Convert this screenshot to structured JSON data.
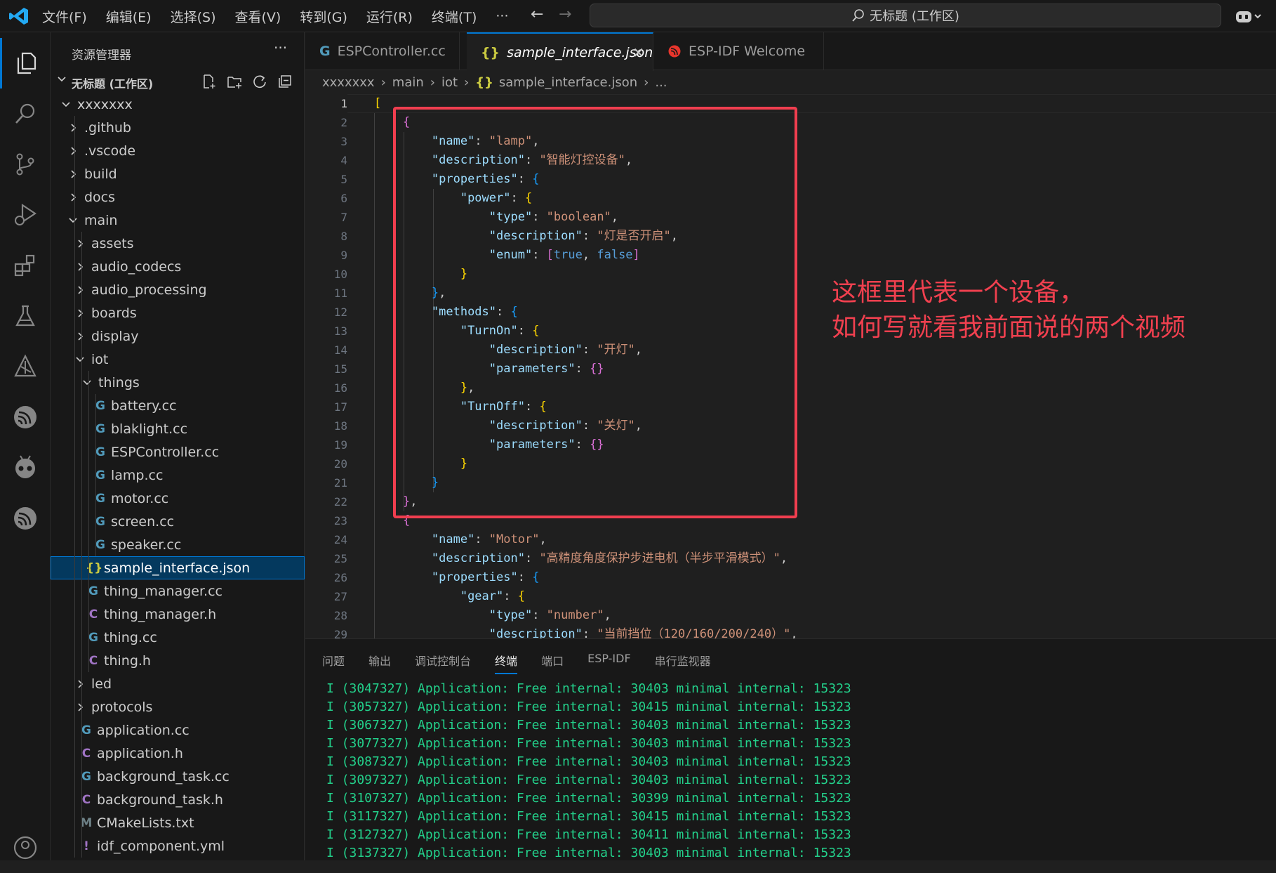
{
  "menu": [
    "文件(F)",
    "编辑(E)",
    "选择(S)",
    "查看(V)",
    "转到(G)",
    "运行(R)",
    "终端(T)",
    "···"
  ],
  "command_center": "无标题 (工作区)",
  "sidebar": {
    "title": "资源管理器",
    "more": "···",
    "workspace": "无标题 (工作区)",
    "tree": [
      {
        "label": "xxxxxxx",
        "depth": 0,
        "kind": "folder-open"
      },
      {
        "label": ".github",
        "depth": 1,
        "kind": "folder"
      },
      {
        "label": ".vscode",
        "depth": 1,
        "kind": "folder"
      },
      {
        "label": "build",
        "depth": 1,
        "kind": "folder"
      },
      {
        "label": "docs",
        "depth": 1,
        "kind": "folder"
      },
      {
        "label": "main",
        "depth": 1,
        "kind": "folder-open"
      },
      {
        "label": "assets",
        "depth": 2,
        "kind": "folder"
      },
      {
        "label": "audio_codecs",
        "depth": 2,
        "kind": "folder"
      },
      {
        "label": "audio_processing",
        "depth": 2,
        "kind": "folder"
      },
      {
        "label": "boards",
        "depth": 2,
        "kind": "folder"
      },
      {
        "label": "display",
        "depth": 2,
        "kind": "folder"
      },
      {
        "label": "iot",
        "depth": 2,
        "kind": "folder-open"
      },
      {
        "label": "things",
        "depth": 3,
        "kind": "folder-open"
      },
      {
        "label": "battery.cc",
        "depth": 4,
        "kind": "cc"
      },
      {
        "label": "blaklight.cc",
        "depth": 4,
        "kind": "cc"
      },
      {
        "label": "ESPController.cc",
        "depth": 4,
        "kind": "cc"
      },
      {
        "label": "lamp.cc",
        "depth": 4,
        "kind": "cc"
      },
      {
        "label": "motor.cc",
        "depth": 4,
        "kind": "cc"
      },
      {
        "label": "screen.cc",
        "depth": 4,
        "kind": "cc"
      },
      {
        "label": "speaker.cc",
        "depth": 4,
        "kind": "cc"
      },
      {
        "label": "sample_interface.json",
        "depth": 3,
        "kind": "json",
        "selected": true
      },
      {
        "label": "thing_manager.cc",
        "depth": 3,
        "kind": "cc"
      },
      {
        "label": "thing_manager.h",
        "depth": 3,
        "kind": "h"
      },
      {
        "label": "thing.cc",
        "depth": 3,
        "kind": "cc"
      },
      {
        "label": "thing.h",
        "depth": 3,
        "kind": "h"
      },
      {
        "label": "led",
        "depth": 2,
        "kind": "folder"
      },
      {
        "label": "protocols",
        "depth": 2,
        "kind": "folder"
      },
      {
        "label": "application.cc",
        "depth": 2,
        "kind": "cc"
      },
      {
        "label": "application.h",
        "depth": 2,
        "kind": "h"
      },
      {
        "label": "background_task.cc",
        "depth": 2,
        "kind": "cc"
      },
      {
        "label": "background_task.h",
        "depth": 2,
        "kind": "h"
      },
      {
        "label": "CMakeLists.txt",
        "depth": 2,
        "kind": "cmake"
      },
      {
        "label": "idf_component.yml",
        "depth": 2,
        "kind": "yml"
      }
    ]
  },
  "tabs": [
    {
      "label": "ESPController.cc",
      "icon": "cc"
    },
    {
      "label": "sample_interface.json",
      "icon": "json",
      "active": true
    },
    {
      "label": "ESP-IDF Welcome",
      "icon": "espressif"
    }
  ],
  "breadcrumb": [
    "xxxxxxx",
    "main",
    "iot",
    "sample_interface.json",
    "..."
  ],
  "editor": {
    "line_numbers": [
      "1",
      "2",
      "3",
      "4",
      "5",
      "6",
      "7",
      "8",
      "9",
      "10",
      "11",
      "12",
      "13",
      "14",
      "15",
      "16",
      "17",
      "18",
      "19",
      "20",
      "21",
      "22",
      "23",
      "24",
      "25",
      "26",
      "27",
      "28",
      "29"
    ],
    "lines": [
      [
        [
          "b1",
          "["
        ]
      ],
      [
        [
          "p",
          "    "
        ],
        [
          "b2",
          "{"
        ]
      ],
      [
        [
          "p",
          "        "
        ],
        [
          "k",
          "\"name\""
        ],
        [
          "p",
          ": "
        ],
        [
          "s",
          "\"lamp\""
        ],
        [
          "p",
          ","
        ]
      ],
      [
        [
          "p",
          "        "
        ],
        [
          "k",
          "\"description\""
        ],
        [
          "p",
          ": "
        ],
        [
          "s",
          "\"智能灯控设备\""
        ],
        [
          "p",
          ","
        ]
      ],
      [
        [
          "p",
          "        "
        ],
        [
          "k",
          "\"properties\""
        ],
        [
          "p",
          ": "
        ],
        [
          "b3",
          "{"
        ]
      ],
      [
        [
          "p",
          "            "
        ],
        [
          "k",
          "\"power\""
        ],
        [
          "p",
          ": "
        ],
        [
          "b1",
          "{"
        ]
      ],
      [
        [
          "p",
          "                "
        ],
        [
          "k",
          "\"type\""
        ],
        [
          "p",
          ": "
        ],
        [
          "s",
          "\"boolean\""
        ],
        [
          "p",
          ","
        ]
      ],
      [
        [
          "p",
          "                "
        ],
        [
          "k",
          "\"description\""
        ],
        [
          "p",
          ": "
        ],
        [
          "s",
          "\"灯是否开启\""
        ],
        [
          "p",
          ","
        ]
      ],
      [
        [
          "p",
          "                "
        ],
        [
          "k",
          "\"enum\""
        ],
        [
          "p",
          ": "
        ],
        [
          "b2",
          "["
        ],
        [
          "kw",
          "true"
        ],
        [
          "p",
          ", "
        ],
        [
          "kw",
          "false"
        ],
        [
          "b2",
          "]"
        ]
      ],
      [
        [
          "p",
          "            "
        ],
        [
          "b1",
          "}"
        ]
      ],
      [
        [
          "p",
          "        "
        ],
        [
          "b3",
          "}"
        ],
        [
          "p",
          ","
        ]
      ],
      [
        [
          "p",
          "        "
        ],
        [
          "k",
          "\"methods\""
        ],
        [
          "p",
          ": "
        ],
        [
          "b3",
          "{"
        ]
      ],
      [
        [
          "p",
          "            "
        ],
        [
          "k",
          "\"TurnOn\""
        ],
        [
          "p",
          ": "
        ],
        [
          "b1",
          "{"
        ]
      ],
      [
        [
          "p",
          "                "
        ],
        [
          "k",
          "\"description\""
        ],
        [
          "p",
          ": "
        ],
        [
          "s",
          "\"开灯\""
        ],
        [
          "p",
          ","
        ]
      ],
      [
        [
          "p",
          "                "
        ],
        [
          "k",
          "\"parameters\""
        ],
        [
          "p",
          ": "
        ],
        [
          "b2",
          "{}"
        ]
      ],
      [
        [
          "p",
          "            "
        ],
        [
          "b1",
          "}"
        ],
        [
          "p",
          ","
        ]
      ],
      [
        [
          "p",
          "            "
        ],
        [
          "k",
          "\"TurnOff\""
        ],
        [
          "p",
          ": "
        ],
        [
          "b1",
          "{"
        ]
      ],
      [
        [
          "p",
          "                "
        ],
        [
          "k",
          "\"description\""
        ],
        [
          "p",
          ": "
        ],
        [
          "s",
          "\"关灯\""
        ],
        [
          "p",
          ","
        ]
      ],
      [
        [
          "p",
          "                "
        ],
        [
          "k",
          "\"parameters\""
        ],
        [
          "p",
          ": "
        ],
        [
          "b2",
          "{}"
        ]
      ],
      [
        [
          "p",
          "            "
        ],
        [
          "b1",
          "}"
        ]
      ],
      [
        [
          "p",
          "        "
        ],
        [
          "b3",
          "}"
        ]
      ],
      [
        [
          "p",
          "    "
        ],
        [
          "b2",
          "}"
        ],
        [
          "p",
          ","
        ]
      ],
      [
        [
          "p",
          "    "
        ],
        [
          "b2",
          "{"
        ]
      ],
      [
        [
          "p",
          "        "
        ],
        [
          "k",
          "\"name\""
        ],
        [
          "p",
          ": "
        ],
        [
          "s",
          "\"Motor\""
        ],
        [
          "p",
          ","
        ]
      ],
      [
        [
          "p",
          "        "
        ],
        [
          "k",
          "\"description\""
        ],
        [
          "p",
          ": "
        ],
        [
          "s",
          "\"高精度角度保护步进电机（半步平滑模式）\""
        ],
        [
          "p",
          ","
        ]
      ],
      [
        [
          "p",
          "        "
        ],
        [
          "k",
          "\"properties\""
        ],
        [
          "p",
          ": "
        ],
        [
          "b3",
          "{"
        ]
      ],
      [
        [
          "p",
          "            "
        ],
        [
          "k",
          "\"gear\""
        ],
        [
          "p",
          ": "
        ],
        [
          "b1",
          "{"
        ]
      ],
      [
        [
          "p",
          "                "
        ],
        [
          "k",
          "\"type\""
        ],
        [
          "p",
          ": "
        ],
        [
          "s",
          "\"number\""
        ],
        [
          "p",
          ","
        ]
      ],
      [
        [
          "p",
          "                "
        ],
        [
          "k",
          "\"description\""
        ],
        [
          "p",
          ": "
        ],
        [
          "s",
          "\"当前挡位（120/160/200/240）\""
        ],
        [
          "p",
          ","
        ]
      ]
    ]
  },
  "annotation": [
    "这框里代表一个设备，",
    "如何写就看我前面说的两个视频"
  ],
  "panel": {
    "tabs": [
      "问题",
      "输出",
      "调试控制台",
      "终端",
      "端口",
      "ESP-IDF",
      "串行监视器"
    ],
    "active_tab": "终端",
    "terminal": [
      "I (3047327) Application: Free internal: 30403 minimal internal: 15323",
      "I (3057327) Application: Free internal: 30415 minimal internal: 15323",
      "I (3067327) Application: Free internal: 30403 minimal internal: 15323",
      "I (3077327) Application: Free internal: 30403 minimal internal: 15323",
      "I (3087327) Application: Free internal: 30403 minimal internal: 15323",
      "I (3097327) Application: Free internal: 30403 minimal internal: 15323",
      "I (3107327) Application: Free internal: 30399 minimal internal: 15323",
      "I (3117327) Application: Free internal: 30415 minimal internal: 15323",
      "I (3127327) Application: Free internal: 30411 minimal internal: 15323",
      "I (3137327) Application: Free internal: 30403 minimal internal: 15323"
    ]
  }
}
